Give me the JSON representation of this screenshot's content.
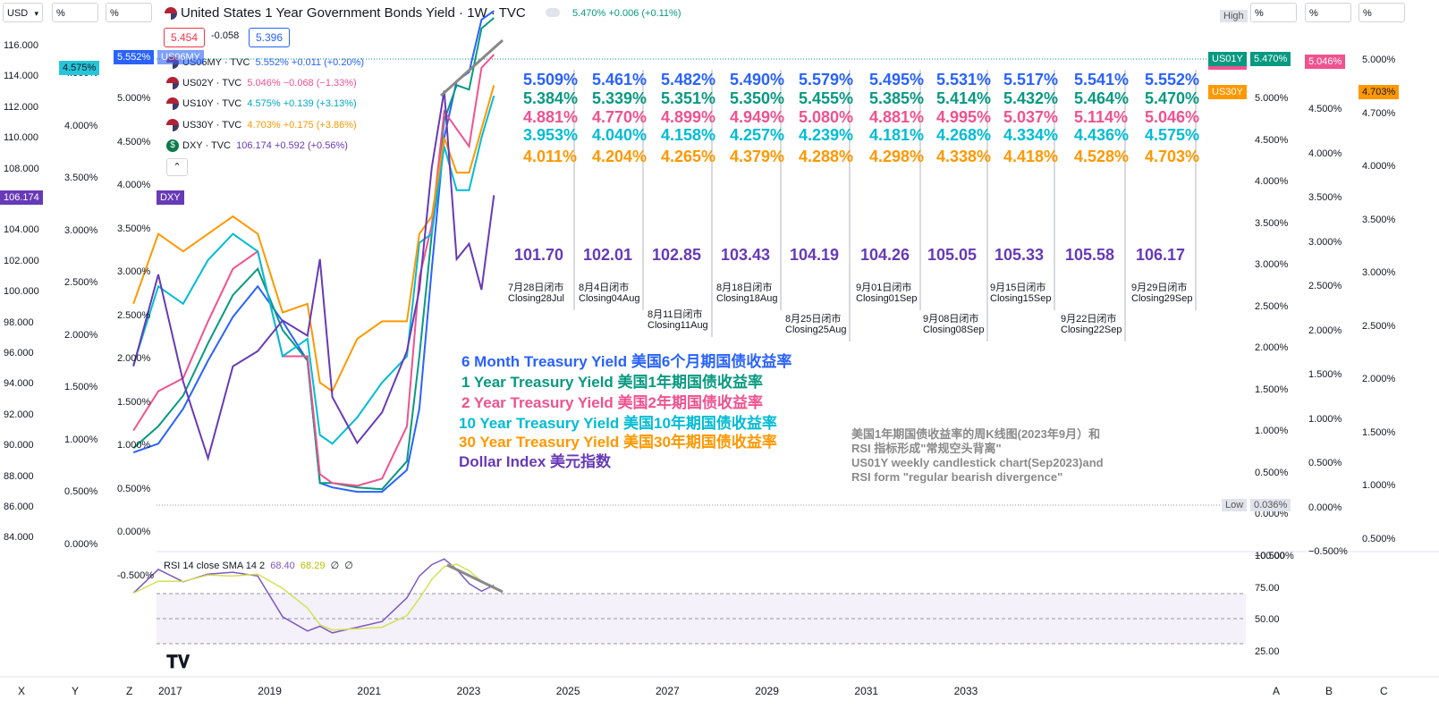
{
  "toolbar": {
    "currency": "USD",
    "pct1": "%",
    "pct2": "%",
    "right_pct1": "%",
    "right_pct2": "%",
    "right_pct3": "%",
    "high_label": "High",
    "low_label": "Low",
    "low_value": "0.036%"
  },
  "header": {
    "title": "United States 1 Year Government Bonds Yield · 1W · TVC",
    "quote": "5.470% +0.006 (+0.11%)",
    "bid": "5.454",
    "spread": "-0.058",
    "ask": "5.396"
  },
  "legend": [
    {
      "label": "US06MY · TVC",
      "value": "5.552% +0.011 (+0.20%)",
      "color": "#2962ff"
    },
    {
      "label": "US02Y · TVC",
      "value": "5.046% −0.068 (−1.33%)",
      "color": "#f0528f"
    },
    {
      "label": "US10Y · TVC",
      "value": "4.575% +0.139 (+3.13%)",
      "color": "#00a8c6"
    },
    {
      "label": "US30Y · TVC",
      "value": "4.703% +0.175 (+3.86%)",
      "color": "#ff9800"
    },
    {
      "label": "DXY · TVC",
      "value": "106.174 +0.592 (+0.56%)",
      "color": "#673ab7"
    }
  ],
  "axes": {
    "dxy_ticks": [
      "116.000",
      "114.000",
      "112.000",
      "110.000",
      "108.000",
      "106.000",
      "104.000",
      "102.000",
      "100.000",
      "98.000",
      "96.000",
      "94.000",
      "92.000",
      "90.000",
      "88.000",
      "86.000",
      "84.000"
    ],
    "left_pct_ticks": [
      "4.500%",
      "4.000%",
      "3.500%",
      "3.000%",
      "2.500%",
      "2.000%",
      "1.500%",
      "1.000%",
      "0.500%",
      "0.000%"
    ],
    "mid_pct_ticks": [
      "5.000%",
      "4.500%",
      "4.000%",
      "3.500%",
      "3.000%",
      "2.500%",
      "2.000%",
      "1.500%",
      "1.000%",
      "0.500%",
      "0.000%",
      "-0.500%"
    ],
    "right1_ticks": [
      "5.000%",
      "4.500%",
      "4.000%",
      "3.500%",
      "3.000%",
      "2.500%",
      "2.000%",
      "1.500%",
      "1.000%",
      "0.500%",
      "0.000%",
      "−0.500%"
    ],
    "right2_ticks": [
      "4.500%",
      "4.000%",
      "3.500%",
      "3.000%",
      "2.500%",
      "2.000%",
      "1.500%",
      "1.000%",
      "0.500%",
      "0.000%",
      "−0.500%"
    ],
    "right3_ticks": [
      "5.000%",
      "4.700%",
      "4.000%",
      "3.500%",
      "3.000%",
      "2.500%",
      "2.000%",
      "1.500%",
      "1.000%",
      "0.500%"
    ],
    "x_ticks": [
      "2017",
      "2019",
      "2021",
      "2023",
      "2025",
      "2027",
      "2029",
      "2031",
      "2033"
    ],
    "corner_left": [
      "X",
      "Y",
      "Z"
    ],
    "corner_right": [
      "A",
      "B",
      "C"
    ]
  },
  "tags": {
    "left_dxy": "106.174",
    "left_pct": "4.575%",
    "mid_6m": "5.552%",
    "mid_6m_label": "US06MY",
    "dxy_label": "DXY",
    "us01y_label": "US01Y",
    "us01y_value": "5.470%",
    "us02y_value": "5.046%",
    "us30y_label": "US30Y",
    "us30y_value": "4.703%"
  },
  "weekly_table": {
    "columns": [
      {
        "us06my": "5.509%",
        "us01y": "5.384%",
        "us02y": "4.881%",
        "us10y": "3.953%",
        "us30y": "4.011%",
        "dxy": "101.70",
        "date_cn": "7月28日闭市",
        "date_en": "Closing28Jul"
      },
      {
        "us06my": "5.461%",
        "us01y": "5.339%",
        "us02y": "4.770%",
        "us10y": "4.040%",
        "us30y": "4.204%",
        "dxy": "102.01",
        "date_cn": "8月4日闭市",
        "date_en": "Closing04Aug"
      },
      {
        "us06my": "5.482%",
        "us01y": "5.351%",
        "us02y": "4.899%",
        "us10y": "4.158%",
        "us30y": "4.265%",
        "dxy": "102.85",
        "date_cn": "8月11日闭市",
        "date_en": "Closing11Aug"
      },
      {
        "us06my": "5.490%",
        "us01y": "5.350%",
        "us02y": "4.949%",
        "us10y": "4.257%",
        "us30y": "4.379%",
        "dxy": "103.43",
        "date_cn": "8月18日闭市",
        "date_en": "Closing18Aug"
      },
      {
        "us06my": "5.579%",
        "us01y": "5.455%",
        "us02y": "5.080%",
        "us10y": "4.239%",
        "us30y": "4.288%",
        "dxy": "104.19",
        "date_cn": "8月25日闭市",
        "date_en": "Closing25Aug"
      },
      {
        "us06my": "5.495%",
        "us01y": "5.385%",
        "us02y": "4.881%",
        "us10y": "4.181%",
        "us30y": "4.298%",
        "dxy": "104.26",
        "date_cn": "9月01日闭市",
        "date_en": "Closing01Sep"
      },
      {
        "us06my": "5.531%",
        "us01y": "5.414%",
        "us02y": "4.995%",
        "us10y": "4.268%",
        "us30y": "4.338%",
        "dxy": "105.05",
        "date_cn": "9月08日闭市",
        "date_en": "Closing08Sep"
      },
      {
        "us06my": "5.517%",
        "us01y": "5.432%",
        "us02y": "5.037%",
        "us10y": "4.334%",
        "us30y": "4.418%",
        "dxy": "105.33",
        "date_cn": "9月15日闭市",
        "date_en": "Closing15Sep"
      },
      {
        "us06my": "5.541%",
        "us01y": "5.464%",
        "us02y": "5.114%",
        "us10y": "4.436%",
        "us30y": "4.528%",
        "dxy": "105.58",
        "date_cn": "9月22日闭市",
        "date_en": "Closing22Sep"
      },
      {
        "us06my": "5.552%",
        "us01y": "5.470%",
        "us02y": "5.046%",
        "us10y": "4.575%",
        "us30y": "4.703%",
        "dxy": "106.17",
        "date_cn": "9月29日闭市",
        "date_en": "Closing29Sep"
      }
    ]
  },
  "annotations": {
    "a6m": "6 Month Treasury Yield 美国6个月期国债收益率",
    "a1y": "1 Year Treasury Yield 美国1年期国债收益率",
    "a2y": "2 Year Treasury Yield 美国2年期国债收益率",
    "a10y": "10 Year Treasury Yield 美国10年期国债收益率",
    "a30y": "30 Year Treasury Yield 美国30年期国债收益率",
    "adxy": "Dollar Index 美元指数",
    "note_cn_1": "美国1年期国债收益率的周K线图(2023年9月）和",
    "note_cn_2": "RSI 指标形成\"常规空头背离\"",
    "note_en_1": "US01Y weekly candlestick chart(Sep2023)and",
    "note_en_2": "RSI form \"regular bearish divergence\""
  },
  "rsi": {
    "label": "RSI 14 close SMA 14 2",
    "value": "68.40",
    "sma": "68.29",
    "v3": "∅",
    "v4": "∅",
    "ticks": [
      "100.00",
      "75.00",
      "50.00",
      "25.00"
    ]
  },
  "colors": {
    "us06my": "#2962ff",
    "us01y": "#089981",
    "us02y": "#f0528f",
    "us10y": "#00bcd4",
    "us30y": "#ff9800",
    "dxy": "#673ab7",
    "rsi": "#7e57c2",
    "rsi_sma": "#d4e157"
  },
  "chart_data": {
    "type": "line",
    "title": "United States 1 Year Government Bonds Yield · 1W · TVC",
    "x_range": [
      "2017",
      "2033"
    ],
    "ylim_pct": [
      -0.5,
      5.0
    ],
    "ylim_dxy": [
      84,
      116
    ],
    "series": [
      {
        "name": "US06MY",
        "x": [
          2016.5,
          2017,
          2017.5,
          2018,
          2018.5,
          2019,
          2019.5,
          2020,
          2020.25,
          2020.5,
          2021,
          2021.5,
          2022,
          2022.25,
          2022.5,
          2022.75,
          2023,
          2023.25,
          2023.5,
          2023.75
        ],
        "values": [
          0.5,
          0.6,
          1.0,
          1.55,
          2.05,
          2.4,
          2.0,
          1.55,
          0.15,
          0.1,
          0.05,
          0.05,
          0.3,
          1.0,
          2.6,
          4.1,
          4.75,
          4.85,
          5.45,
          5.55
        ]
      },
      {
        "name": "US01Y",
        "x": [
          2016.5,
          2017,
          2017.5,
          2018,
          2018.5,
          2019,
          2019.5,
          2020,
          2020.25,
          2020.5,
          2021,
          2021.5,
          2022,
          2022.25,
          2022.5,
          2022.75,
          2023,
          2023.25,
          2023.5,
          2023.75
        ],
        "values": [
          0.55,
          0.8,
          1.15,
          1.75,
          2.3,
          2.6,
          1.9,
          1.55,
          0.15,
          0.15,
          0.1,
          0.08,
          0.4,
          1.6,
          3.0,
          4.3,
          4.7,
          4.65,
          5.35,
          5.47
        ]
      },
      {
        "name": "US02Y",
        "x": [
          2016.5,
          2017,
          2017.5,
          2018,
          2018.5,
          2019,
          2019.5,
          2020,
          2020.25,
          2020.5,
          2021,
          2021.5,
          2022,
          2022.25,
          2022.5,
          2022.75,
          2023,
          2023.25,
          2023.5,
          2023.75
        ],
        "values": [
          0.75,
          1.2,
          1.35,
          2.0,
          2.6,
          2.8,
          1.6,
          1.6,
          0.25,
          0.15,
          0.12,
          0.2,
          0.8,
          2.5,
          3.1,
          4.4,
          4.2,
          4.0,
          4.9,
          5.05
        ]
      },
      {
        "name": "US10Y",
        "x": [
          2016.5,
          2017,
          2017.5,
          2018,
          2018.5,
          2019,
          2019.5,
          2020,
          2020.25,
          2020.5,
          2021,
          2021.5,
          2022,
          2022.25,
          2022.5,
          2022.75,
          2023,
          2023.25,
          2023.5,
          2023.75
        ],
        "values": [
          1.5,
          2.4,
          2.2,
          2.7,
          3.0,
          2.8,
          1.6,
          1.8,
          0.7,
          0.6,
          0.9,
          1.3,
          1.6,
          2.9,
          3.0,
          4.0,
          3.5,
          3.5,
          4.1,
          4.58
        ]
      },
      {
        "name": "US30Y",
        "x": [
          2016.5,
          2017,
          2017.5,
          2018,
          2018.5,
          2019,
          2019.5,
          2020,
          2020.25,
          2020.5,
          2021,
          2021.5,
          2022,
          2022.25,
          2022.5,
          2022.75,
          2023,
          2023.25,
          2023.5,
          2023.75
        ],
        "values": [
          2.2,
          3.0,
          2.8,
          3.0,
          3.2,
          3.0,
          2.1,
          2.2,
          1.3,
          1.2,
          1.8,
          2.0,
          2.0,
          3.0,
          3.2,
          4.1,
          3.7,
          3.7,
          4.2,
          4.7
        ]
      },
      {
        "name": "DXY",
        "x": [
          2016.5,
          2017,
          2017.5,
          2018,
          2018.5,
          2019,
          2019.5,
          2020,
          2020.25,
          2020.5,
          2021,
          2021.5,
          2022,
          2022.25,
          2022.5,
          2022.75,
          2023,
          2023.25,
          2023.5,
          2023.75
        ],
        "values": [
          95,
          101,
          94,
          89,
          95,
          96,
          98,
          97,
          102,
          93,
          90,
          92,
          96,
          100,
          108,
          113,
          102,
          103,
          100,
          106.17
        ]
      }
    ],
    "rsi": {
      "x": [
        2016.5,
        2017,
        2017.5,
        2018,
        2018.5,
        2019,
        2019.5,
        2020,
        2020.25,
        2020.5,
        2021,
        2021.5,
        2022,
        2022.25,
        2022.5,
        2022.75,
        2023,
        2023.25,
        2023.5,
        2023.75
      ],
      "values": [
        60,
        85,
        72,
        80,
        82,
        78,
        35,
        20,
        25,
        18,
        24,
        30,
        55,
        78,
        90,
        96,
        85,
        70,
        62,
        68.4
      ]
    }
  }
}
